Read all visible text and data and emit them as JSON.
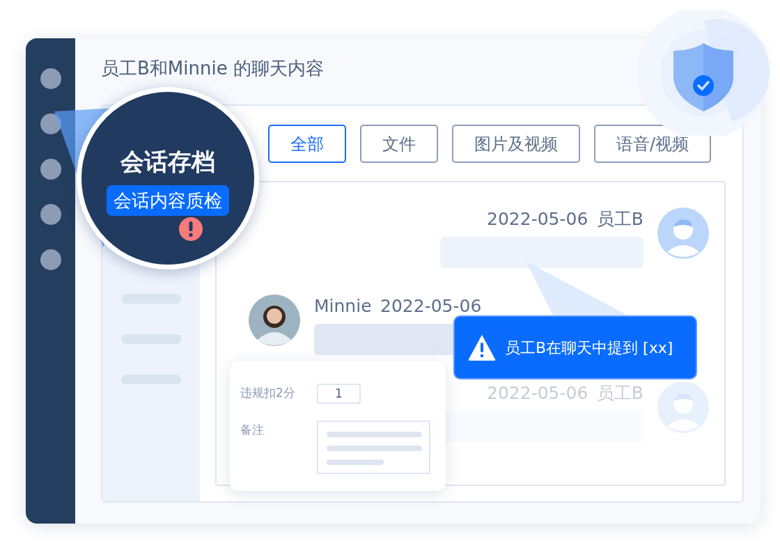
{
  "title": "员工B和Minnie 的聊天内容",
  "tabs": [
    {
      "label": "全部",
      "selected": true
    },
    {
      "label": "文件",
      "selected": false
    },
    {
      "label": "图片及视频",
      "selected": false
    },
    {
      "label": "语音/视频",
      "selected": false
    }
  ],
  "messages": [
    {
      "kind": "outgoing",
      "date": "2022-05-06",
      "sender": "员工B",
      "faded": false
    },
    {
      "kind": "incoming",
      "sender": "Minnie",
      "date": "2022-05-06",
      "faded": false
    },
    {
      "kind": "outgoing",
      "date": "2022-05-06",
      "sender": "员工B",
      "faded": true
    }
  ],
  "magnifier": {
    "title": "会话存档",
    "badge": "会话内容质检"
  },
  "alert": {
    "text": "员工B在聊天中提到 [xx]"
  },
  "score_card": {
    "fields": [
      {
        "kind": "input",
        "label": "违规扣2分",
        "value": "1"
      },
      {
        "kind": "textarea",
        "label": "备注"
      }
    ]
  }
}
